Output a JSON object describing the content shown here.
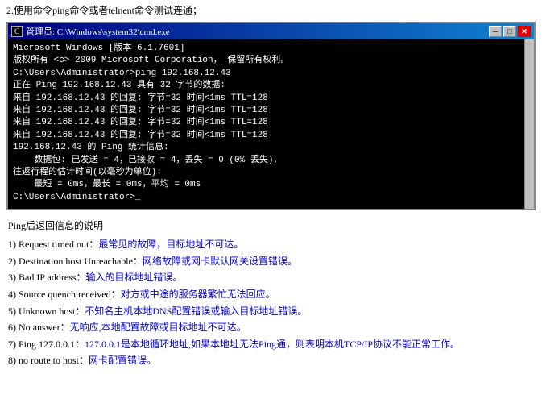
{
  "instruction": "2.使用命令ping命令或者telnent命令测试连通；",
  "cmd": {
    "title": "管理员: C:\\Windows\\system32\\cmd.exe",
    "lines": [
      {
        "text": "Microsoft Windows [版本 6.1.7601]",
        "style": "white"
      },
      {
        "text": "版权所有 <c> 2009 Microsoft Corporation， 保留所有权利。",
        "style": "white"
      },
      {
        "text": "",
        "style": "gray"
      },
      {
        "text": "C:\\Users\\Administrator>ping 192.168.12.43",
        "style": "white"
      },
      {
        "text": "",
        "style": "gray"
      },
      {
        "text": "正在 Ping 192.168.12.43 具有 32 字节的数据:",
        "style": "white"
      },
      {
        "text": "来自 192.168.12.43 的回复: 字节=32 时间<1ms TTL=128",
        "style": "white"
      },
      {
        "text": "来自 192.168.12.43 的回复: 字节=32 时间<1ms TTL=128",
        "style": "white"
      },
      {
        "text": "来自 192.168.12.43 的回复: 字节=32 时间<1ms TTL=128",
        "style": "white"
      },
      {
        "text": "来自 192.168.12.43 的回复: 字节=32 时间<1ms TTL=128",
        "style": "white"
      },
      {
        "text": "",
        "style": "gray"
      },
      {
        "text": "192.168.12.43 的 Ping 统计信息:",
        "style": "white"
      },
      {
        "text": "    数据包: 已发送 = 4，已接收 = 4，丢失 = 0 (0% 丢失),",
        "style": "white"
      },
      {
        "text": "往返行程的估计时间(以毫秒为单位):",
        "style": "white"
      },
      {
        "text": "    最短 = 0ms，最长 = 0ms，平均 = 0ms",
        "style": "white"
      },
      {
        "text": "",
        "style": "gray"
      },
      {
        "text": "C:\\Users\\Administrator>_",
        "style": "white"
      }
    ]
  },
  "info": {
    "title": "Ping后返回信息的说明",
    "items": [
      {
        "num": "1)",
        "label": "Request timed out：",
        "desc": "最常见的故障，目标地址不可达。"
      },
      {
        "num": "2)",
        "label": "Destination host Unreachable：",
        "desc": "网络故障或网卡默认网关设置错误。"
      },
      {
        "num": "3)",
        "label": "Bad IP address：",
        "desc": "输入的目标地址错误。"
      },
      {
        "num": "4)",
        "label": "Source quench received：",
        "desc": "对方或中途的服务器繁忙无法回应。"
      },
      {
        "num": "5)",
        "label": "Unknown host：",
        "desc": "不知名主机本地DNS配置错误或输入目标地址错误。"
      },
      {
        "num": "6)",
        "label": "No answer：",
        "desc": "无响应,本地配置故障或目标地址不可达。"
      },
      {
        "num": "7)",
        "label": "Ping 127.0.0.1：",
        "desc": "127.0.0.1是本地循环地址,如果本地址无法Ping通，则表明本机TCP/IP协议不能正常工作。"
      },
      {
        "num": "8)",
        "label": "no route to host：",
        "desc": "网卡配置错误。"
      }
    ]
  }
}
